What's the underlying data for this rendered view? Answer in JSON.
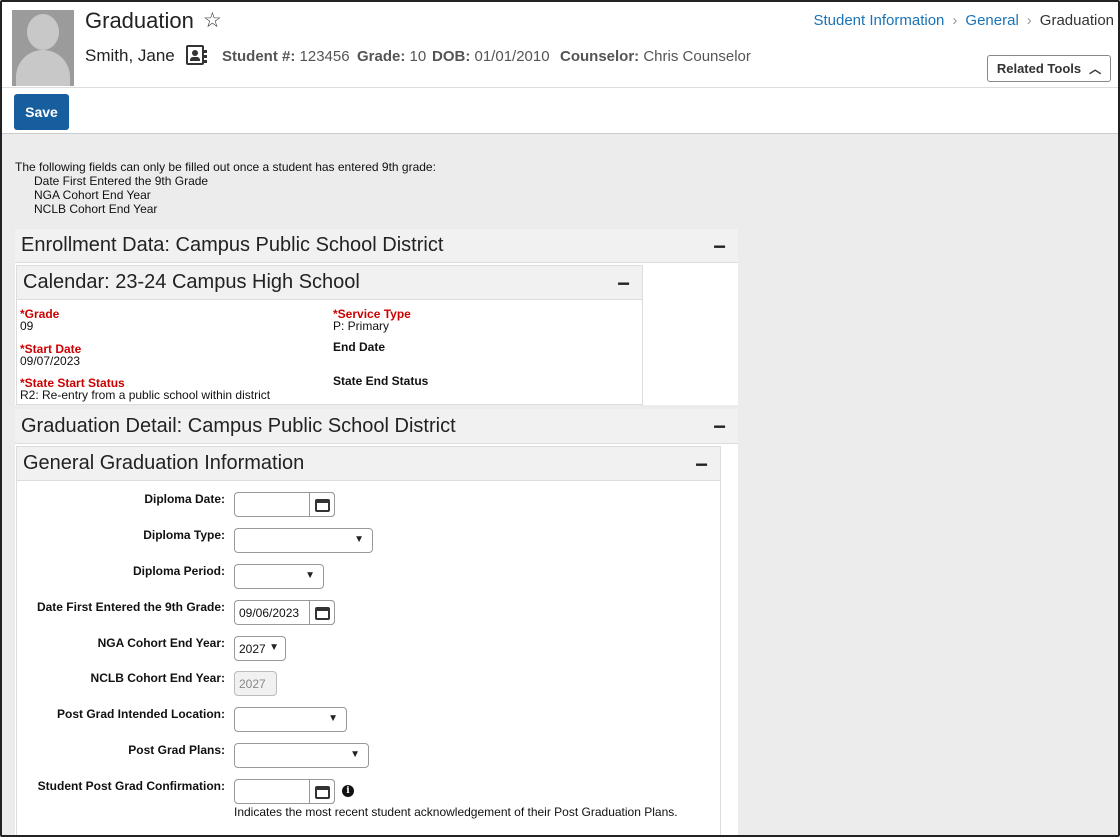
{
  "header": {
    "title": "Graduation",
    "student_name": "Smith, Jane",
    "student_num_label": "Student #:",
    "student_num": "123456",
    "grade_label": "Grade:",
    "grade": "10",
    "dob_label": "DOB:",
    "dob": "01/01/2010",
    "counselor_label": "Counselor:",
    "counselor": "Chris Counselor",
    "breadcrumb": [
      "Student Information",
      "General",
      "Graduation"
    ],
    "related_tools": "Related Tools"
  },
  "toolbar": {
    "save_label": "Save"
  },
  "notice": {
    "intro": "The following fields can only be filled out once a student has entered 9th grade:",
    "items": [
      "Date First Entered the 9th Grade",
      "NGA Cohort End Year",
      "NCLB Cohort End Year"
    ]
  },
  "enrollment": {
    "title": "Enrollment Data: Campus Public School District",
    "calendar_title": "Calendar: 23-24 Campus High School",
    "grade_label": "Grade",
    "grade_value": "09",
    "service_type_label": "Service Type",
    "service_type_value": "P: Primary",
    "start_date_label": "Start Date",
    "start_date_value": "09/07/2023",
    "end_date_label": "End Date",
    "state_start_label": "State Start Status",
    "state_start_value": "R2: Re-entry from a public school within district",
    "state_end_label": "State End Status",
    "required_marker": "*"
  },
  "graduation": {
    "title": "Graduation Detail: Campus Public School District",
    "general_title": "General Graduation Information",
    "fields": {
      "diploma_date": {
        "label": "Diploma Date:",
        "value": ""
      },
      "diploma_type": {
        "label": "Diploma Type:",
        "value": ""
      },
      "diploma_period": {
        "label": "Diploma Period:",
        "value": ""
      },
      "first_9th": {
        "label": "Date First Entered the 9th Grade:",
        "value": "09/06/2023"
      },
      "nga_year": {
        "label": "NGA Cohort End Year:",
        "value": "2027"
      },
      "nclb_year": {
        "label": "NCLB Cohort End Year:",
        "value": "2027"
      },
      "intended_location": {
        "label": "Post Grad Intended Location:",
        "value": ""
      },
      "post_plans": {
        "label": "Post Grad Plans:",
        "value": ""
      },
      "confirmation": {
        "label": "Student Post Grad Confirmation:",
        "value": ""
      }
    },
    "confirmation_help": "Indicates the most recent student acknowledgement of their Post Graduation Plans."
  },
  "icons": [
    "star-icon",
    "contact-card-icon",
    "chevron-right-icon",
    "chevron-up-icon",
    "collapse-icon",
    "calendar-icon",
    "dropdown-caret-icon",
    "info-icon"
  ],
  "colors": {
    "link": "#1a73b8",
    "save": "#175e9e",
    "required": "#cc0000"
  }
}
